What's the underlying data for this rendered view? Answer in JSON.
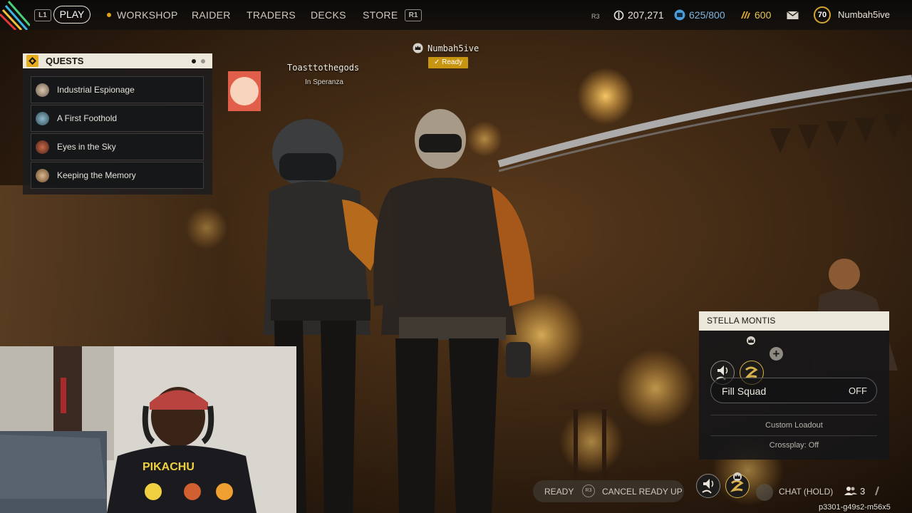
{
  "topbar": {
    "left_bumper": "L1",
    "right_bumper": "R1",
    "play_label": "PLAY",
    "nav_items": [
      "WORKSHOP",
      "RAIDER",
      "TRADERS",
      "DECKS",
      "STORE"
    ],
    "r3_label": "R3",
    "coins": "207,271",
    "storage": "625/800",
    "tokens": "600",
    "player_level": "70",
    "player_name": "Numbah5ive",
    "colors": {
      "accent": "#e0a41b",
      "storage_blue": "#4a9bd6"
    }
  },
  "quests": {
    "title": "QUESTS",
    "pages": 2,
    "current_page": 1,
    "items": [
      {
        "label": "Industrial Espionage",
        "icon": "quest-giver-portrait-icon"
      },
      {
        "label": "A First Foothold",
        "icon": "quest-giver-portrait-icon"
      },
      {
        "label": "Eyes in the Sky",
        "icon": "quest-giver-portrait-icon"
      },
      {
        "label": "Keeping the Memory",
        "icon": "quest-giver-portrait-icon"
      }
    ]
  },
  "players": [
    {
      "name": "Toasttothegods",
      "status": "In Speranza"
    },
    {
      "name": "Numbah5ive",
      "status": "Ready",
      "leader_icon": "crown-icon"
    }
  ],
  "squad": {
    "title": "STELLA MONTIS",
    "fill_squad_label": "Fill Squad",
    "fill_squad_value": "OFF",
    "custom_loadout": "Custom Loadout",
    "crossplay": "Crossplay: Off"
  },
  "bottom": {
    "ready_label": "READY",
    "r3_label": "R3",
    "cancel_label": "CANCEL READY UP",
    "chat_label": "CHAT (HOLD)",
    "squad_count": "3"
  },
  "session_id": "p3301-g49s2-m56x5"
}
